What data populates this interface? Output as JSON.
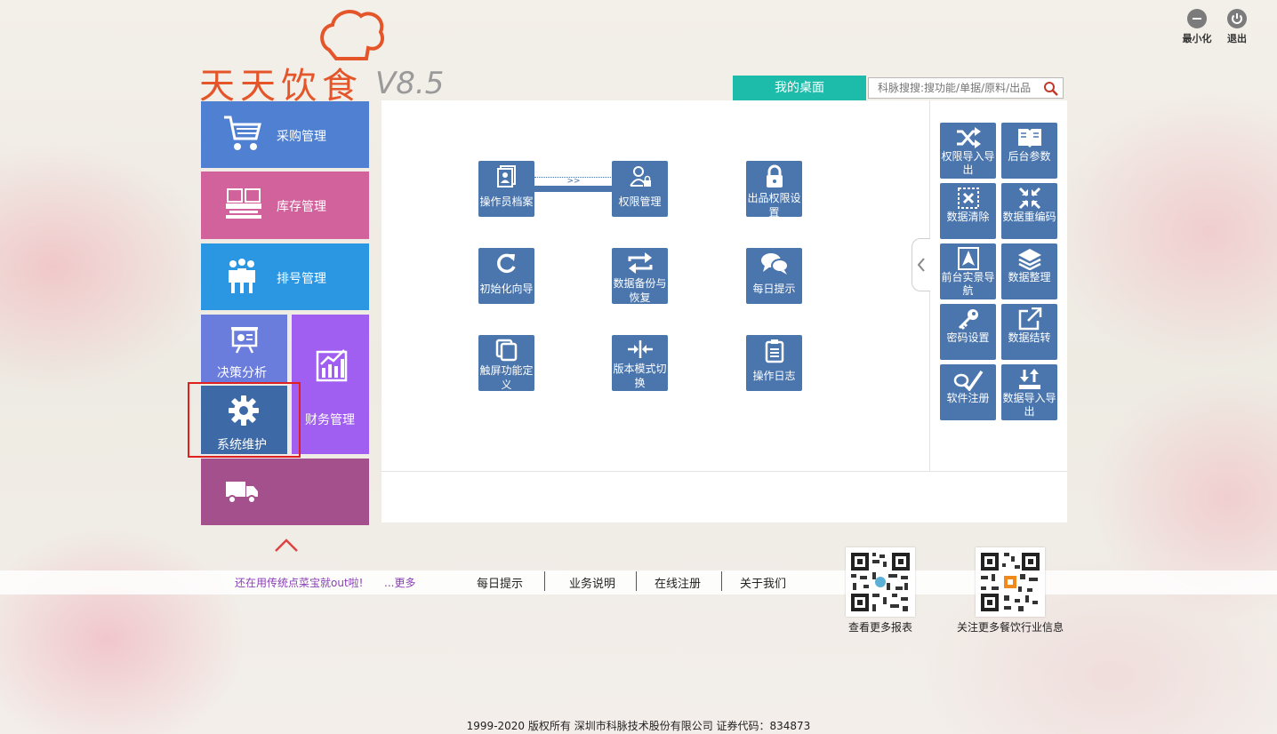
{
  "window": {
    "minimize_label": "最小化",
    "exit_label": "退出"
  },
  "logo": {
    "title": "天天饮食",
    "version": "V8.5"
  },
  "header": {
    "desk_tab": "我的桌面",
    "search_placeholder": "科脉搜搜:搜功能/单据/原料/出品"
  },
  "menu": {
    "purchase": "采购管理",
    "inventory": "库存管理",
    "queue": "排号管理",
    "decision": "决策分析",
    "finance": "财务管理",
    "system": "系统维护"
  },
  "functions": {
    "operator_file": "操作员档案",
    "flow_arrow": ">>",
    "permission": "权限管理",
    "dish_permission": "出品权限设置",
    "init_wizard": "初始化向导",
    "backup_restore": "数据备份与恢复",
    "daily_tip": "每日提示",
    "touch_define": "触屏功能定义",
    "version_switch": "版本模式切换",
    "op_log": "操作日志"
  },
  "side_tools": {
    "perm_io": "权限导入导出",
    "backend_params": "后台参数",
    "data_clear": "数据清除",
    "data_recode": "数据重编码",
    "front_nav": "前台实景导航",
    "data_arrange": "数据整理",
    "password": "密码设置",
    "data_carry": "数据结转",
    "register": "软件注册",
    "data_io": "数据导入导出"
  },
  "footer": {
    "promo": "还在用传统点菜宝就out啦!",
    "more": "...更多",
    "links": [
      "每日提示",
      "业务说明",
      "在线注册",
      "关于我们"
    ],
    "qr1_caption": "查看更多报表",
    "qr2_caption": "关注更多餐饮行业信息",
    "copyright": "1999-2020  版权所有  深圳市科脉技术股份有限公司  证券代码：834873"
  },
  "colors": {
    "purchase": "#4f80d2",
    "inventory": "#d2629c",
    "queue": "#2b97e2",
    "decision": "#6a7cdc",
    "finance": "#a05ff0",
    "system": "#3d6aa6",
    "logistics": "#a4508c",
    "desk_tab": "#1dbba9",
    "function_icon": "#4a76ad",
    "highlight": "#e02020"
  }
}
